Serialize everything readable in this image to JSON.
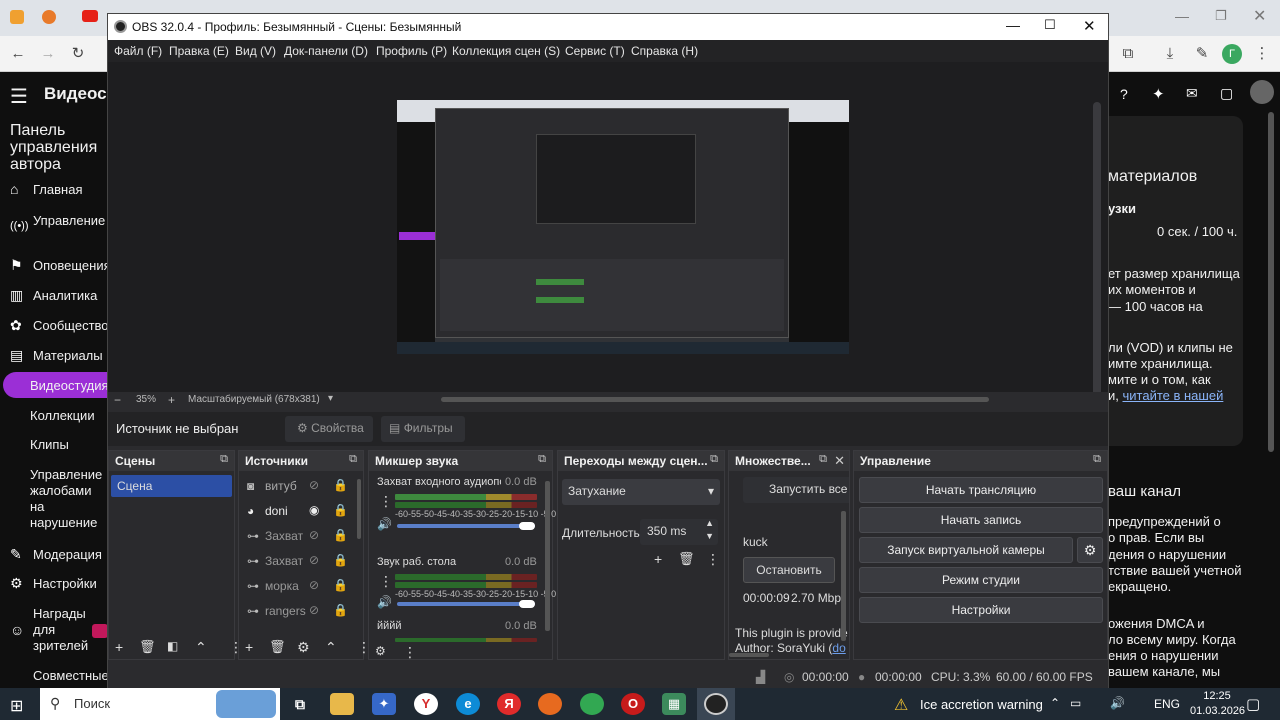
{
  "browser": {
    "nav_icons": [
      "back-icon",
      "forward-icon",
      "reload-icon"
    ],
    "right_icons": [
      "extensions-icon",
      "download-icon",
      "edit-icon",
      "profile-icon",
      "menu-icon"
    ],
    "profile_letter": "Г"
  },
  "youtube": {
    "title": "Видеост",
    "panel_title": "Панель управления автора",
    "nav": [
      "Главная",
      "Управление трансляцией",
      "Оповещения",
      "Аналитика",
      "Сообщество",
      "Материалы",
      "Видеостудия",
      "Коллекции",
      "Клипы",
      "Управление жалобами на нарушение авторских прав",
      "Модерация",
      "Настройки",
      "Награды для зрителей",
      "Совместные"
    ],
    "right": {
      "materials": "материалов",
      "uploads": "узки",
      "quota": "0 сек. / 100 ч.",
      "line1": "ет размер хранилища",
      "line2": "их моментов и",
      "line3": "— 100 часов на",
      "line4": "ли (VOD) и клипы не",
      "line5": "имте хранилища.",
      "line6": "мите и о том, как",
      "line7_a": "и, ",
      "line7_link": "читайте в нашей",
      "channel": "ваш канал",
      "c1": "предупреждений о",
      "c2": "о прав. Если вы",
      "c3": "дения о нарушении",
      "c4": "тствие вашей учетной",
      "c5": "екращено.",
      "c6": "ожения DMCA и",
      "c7": "ло всему миру. Когда",
      "c8": "ения о нарушении",
      "c9": "вашем канале, мы"
    }
  },
  "obs": {
    "title": "OBS 32.0.4 - Профиль: Безымянный - Сцены: Безымянный",
    "menu": [
      "Файл (F)",
      "Правка (E)",
      "Вид (V)",
      "Док-панели (D)",
      "Профиль (P)",
      "Коллекция сцен (S)",
      "Сервис (T)",
      "Справка (H)"
    ],
    "zoom": "35%",
    "scale_mode": "Масштабируемый (678x381)",
    "no_source": "Источник не выбран",
    "properties": "Свойства",
    "filters": "Фильтры",
    "scenes": {
      "title": "Сцены",
      "items": [
        "Сцена"
      ]
    },
    "sources": {
      "title": "Источники",
      "items": [
        {
          "name": "витуб",
          "icon": "camera-icon"
        },
        {
          "name": "doni",
          "icon": "browser-icon"
        },
        {
          "name": "Захват",
          "icon": "link-icon"
        },
        {
          "name": "Захват",
          "icon": "link-icon"
        },
        {
          "name": "морка",
          "icon": "link-icon"
        },
        {
          "name": "rangers",
          "icon": "link-icon"
        }
      ]
    },
    "mixer": {
      "title": "Микшер звука",
      "channels": [
        {
          "name": "Захват входного аудиопоток",
          "db": "0.0 dB"
        },
        {
          "name": "Звук раб. стола",
          "db": "0.0 dB"
        },
        {
          "name": "йййй",
          "db": "0.0 dB"
        }
      ],
      "scale": "-60-55-50-45-40-35-30-25-20-15-10 -5  0"
    },
    "transitions": {
      "title": "Переходы между сцен...",
      "selected": "Затухание",
      "duration_label": "Длительность",
      "duration": "350 ms"
    },
    "multi": {
      "title": "Множестве...",
      "start": "Запустить все",
      "name": "kuck",
      "stop": "Остановить",
      "time": "00:00:09",
      "rate": "2.70 Mbp",
      "plugin": "This plugin is provide",
      "author_a": "Author: SoraYuki (",
      "author_link": "do"
    },
    "controls": {
      "title": "Управление",
      "buttons": [
        "Начать трансляцию",
        "Начать запись",
        "Запуск виртуальной камеры",
        "Режим студии",
        "Настройки"
      ]
    },
    "status": {
      "live": "00:00:00",
      "rec": "00:00:00",
      "cpu": "CPU: 3.3%",
      "fps": "60.00 / 60.00 FPS"
    }
  },
  "taskbar": {
    "search": "Поиск",
    "warning": "Ice accretion warning",
    "lang": "ENG",
    "time": "12:25",
    "date": "01.03.2026"
  }
}
